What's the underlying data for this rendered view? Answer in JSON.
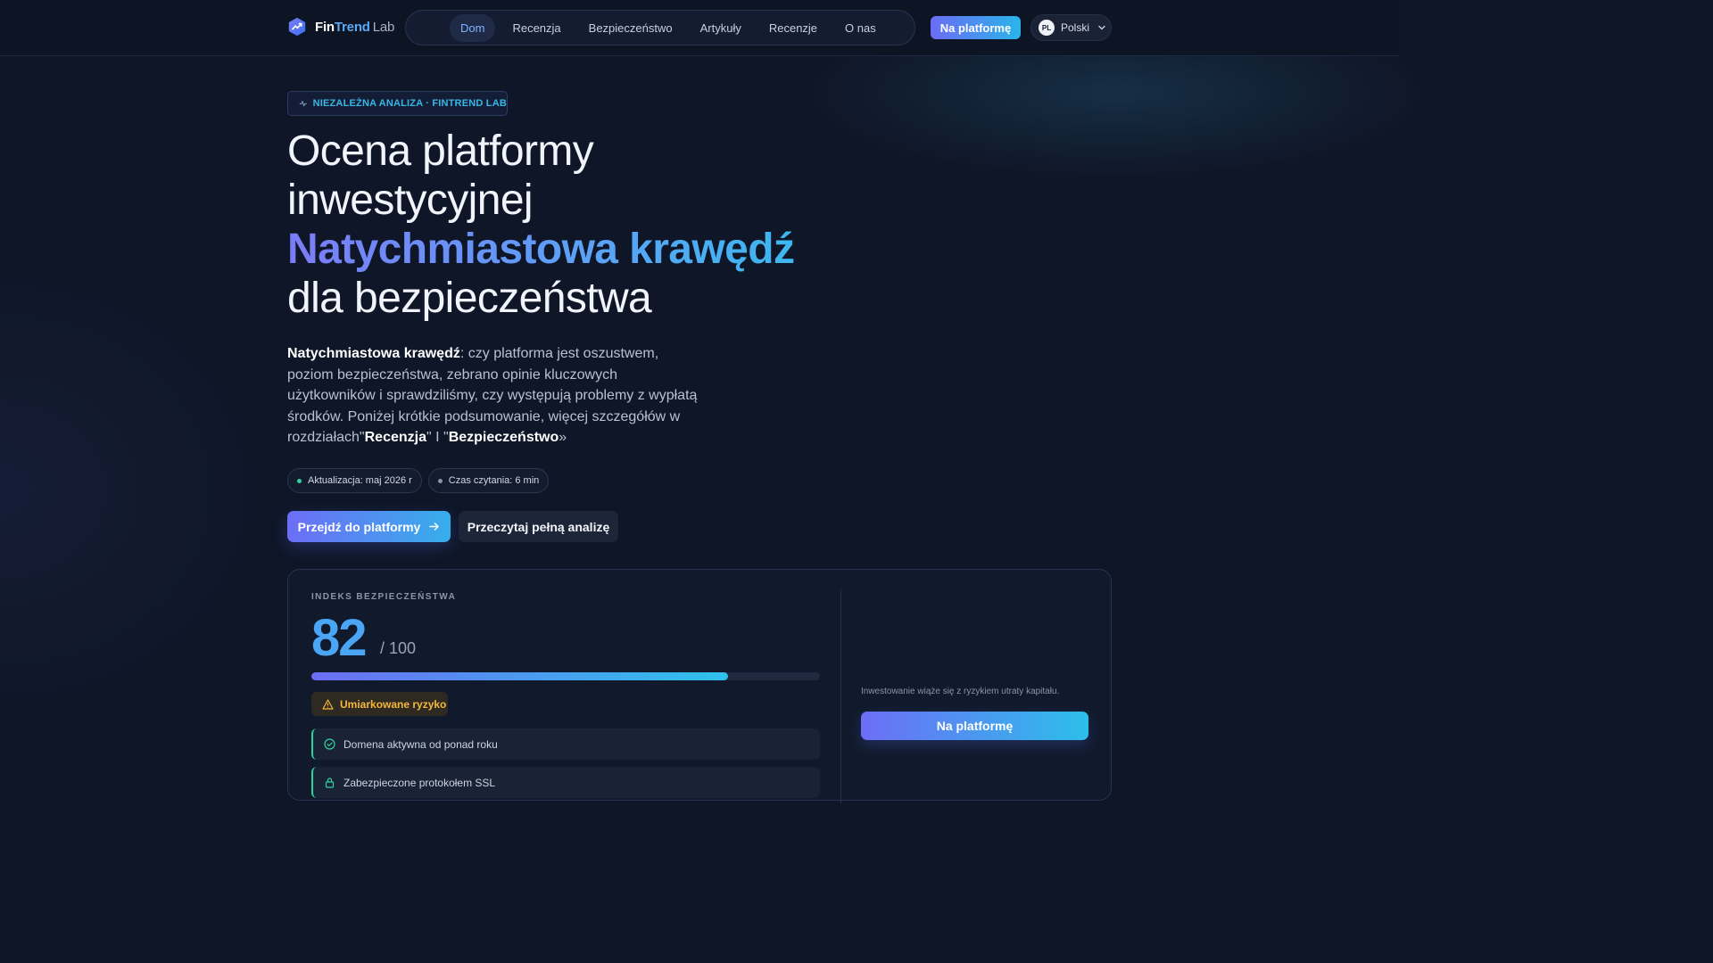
{
  "brand": {
    "fin": "Fin",
    "trend": "Trend",
    "lab": "Lab",
    "logo_icon": "trend-chart-icon"
  },
  "nav": {
    "items": [
      {
        "label": "Dom",
        "active": true
      },
      {
        "label": "Recenzja",
        "active": false
      },
      {
        "label": "Bezpieczeństwo",
        "active": false
      },
      {
        "label": "Artykuły",
        "active": false
      },
      {
        "label": "Recenzje",
        "active": false
      },
      {
        "label": "O nas",
        "active": false
      }
    ],
    "cta_label": "Na platformę",
    "language": {
      "badge": "PL",
      "label": "Polski"
    }
  },
  "hero": {
    "tag": "NIEZALEŻNA ANALIZA · FINTREND LAB",
    "title_line1": "Ocena platformy",
    "title_line2": "inwestycyjnej",
    "title_highlight": "Natychmiastowa krawędź",
    "title_line4": "dla bezpieczeństwa",
    "lead_strong": "Natychmiastowa krawędź",
    "lead_text": ": czy platforma jest oszustwem, poziom bezpieczeństwa, zebrano opinie kluczowych użytkowników i sprawdziliśmy, czy występują problemy z wypłatą środków. Poniżej krótkie podsumowanie, więcej szczegółów w rozdziałach\"",
    "lead_link1": "Recenzja",
    "lead_mid": "\" I \"",
    "lead_link2": "Bezpieczeństwo",
    "lead_end": "»",
    "meta": [
      {
        "label": "Aktualizacja: maj 2026 r",
        "dot_color": "#2dd4a0"
      },
      {
        "label": "Czas czytania: 6 min",
        "dot_color": "#8a94ab"
      }
    ],
    "primary_button": "Przejdź do platformy",
    "secondary_button": "Przeczytaj pełną analizę"
  },
  "safety_card": {
    "label": "INDEKS BEZPIECZEŃSTWA",
    "score": "82",
    "score_max": "/ 100",
    "score_fraction": 0.82,
    "risk_label": "Umiarkowane ryzyko",
    "checks": [
      {
        "label": "Domena aktywna od ponad roku",
        "icon": "check-circle-icon"
      },
      {
        "label": "Zabezpieczone protokołem SSL",
        "icon": "lock-icon"
      }
    ],
    "disclaimer": "Inwestowanie wiąże się z ryzykiem utraty kapitału.",
    "cta_label": "Na platformę"
  },
  "colors": {
    "accent_start": "#6c6ef6",
    "accent_end": "#2cc3ea",
    "warning": "#f4b73a",
    "success": "#2dd4a0"
  }
}
